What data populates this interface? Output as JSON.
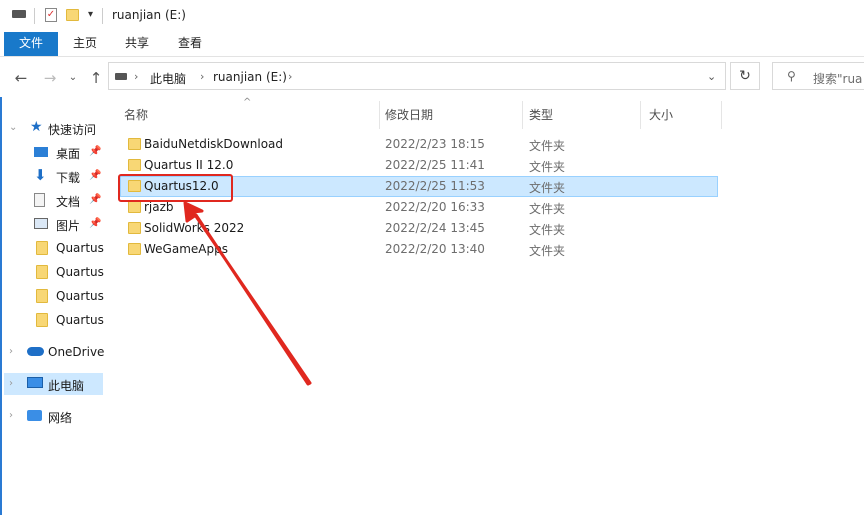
{
  "window": {
    "title": "ruanjian (E:)"
  },
  "ribbon": {
    "tabs": [
      "文件",
      "主页",
      "共享",
      "查看"
    ]
  },
  "address": {
    "crumbs": [
      "此电脑",
      "ruanjian (E:)"
    ],
    "search_placeholder": "搜索\"rua"
  },
  "nav": {
    "quick_access": "快速访问",
    "pinned": [
      "桌面",
      "下载",
      "文档",
      "图片"
    ],
    "recent": [
      "Quartus",
      "Quartus",
      "Quartus",
      "Quartus"
    ],
    "onedrive": "OneDrive",
    "this_pc": "此电脑",
    "network": "网络"
  },
  "columns": {
    "name": "名称",
    "date": "修改日期",
    "type": "类型",
    "size": "大小"
  },
  "files": [
    {
      "name": "BaiduNetdiskDownload",
      "date": "2022/2/23 18:15",
      "type": "文件夹"
    },
    {
      "name": "Quartus II 12.0",
      "date": "2022/2/25 11:41",
      "type": "文件夹"
    },
    {
      "name": "Quartus12.0",
      "date": "2022/2/25 11:53",
      "type": "文件夹"
    },
    {
      "name": "rjazb",
      "date": "2022/2/20 16:33",
      "type": "文件夹"
    },
    {
      "name": "SolidWorks 2022",
      "date": "2022/2/24 13:45",
      "type": "文件夹"
    },
    {
      "name": "WeGameApps",
      "date": "2022/2/20 13:40",
      "type": "文件夹"
    }
  ],
  "colors": {
    "accent": "#1979ca",
    "selection": "#cce8ff",
    "annotation": "#e0281f",
    "folder": "#f8d775"
  }
}
